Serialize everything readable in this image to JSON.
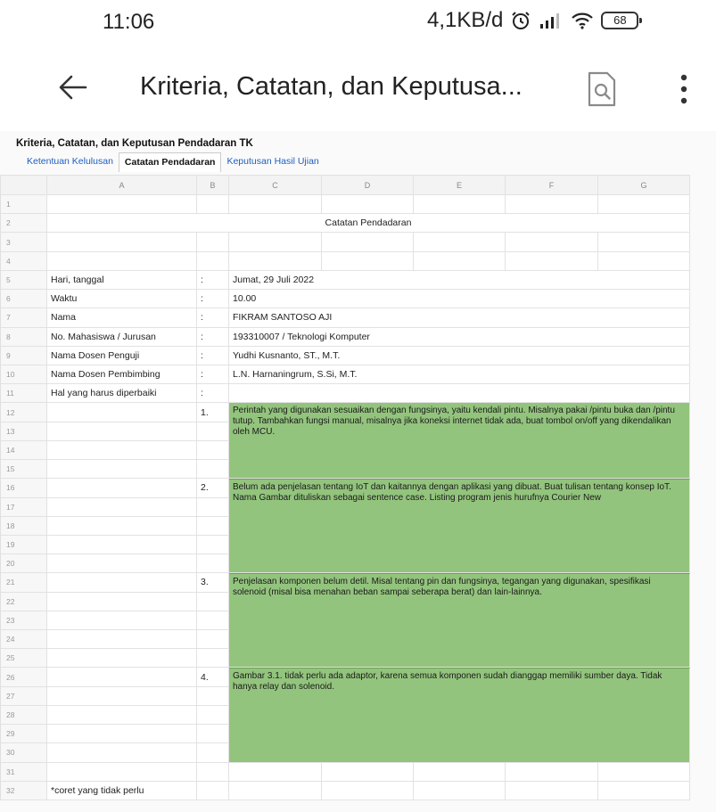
{
  "status_bar": {
    "time": "11:06",
    "net_speed": "4,1KB/d",
    "battery": "68"
  },
  "app_bar": {
    "title": "Kriteria, Catatan, dan Keputusa..."
  },
  "sheet": {
    "doc_title": "Kriteria, Catatan, dan Keputusan Pendadaran TK",
    "tabs": [
      "Ketentuan Kelulusan",
      "Catatan Pendadaran",
      "Keputusan Hasil Ujian"
    ],
    "active_tab": "Catatan Pendadaran",
    "columns": [
      "A",
      "B",
      "C",
      "D",
      "E",
      "F",
      "G"
    ],
    "row_numbers": [
      "1",
      "2",
      "3",
      "4",
      "5",
      "6",
      "7",
      "8",
      "9",
      "10",
      "11",
      "12",
      "13",
      "14",
      "15",
      "16",
      "17",
      "18",
      "19",
      "20",
      "21",
      "22",
      "23",
      "24",
      "25",
      "26",
      "27",
      "28",
      "29",
      "30",
      "31",
      "32"
    ],
    "heading": "Catatan Pendadaran",
    "fields": [
      {
        "label": "Hari, tanggal",
        "sep": ":",
        "value": "Jumat, 29 Juli 2022"
      },
      {
        "label": "Waktu",
        "sep": ":",
        "value": "10.00"
      },
      {
        "label": "Nama",
        "sep": ":",
        "value": "FIKRAM SANTOSO AJI"
      },
      {
        "label": "No. Mahasiswa / Jurusan",
        "sep": ":",
        "value": "193310007 / Teknologi Komputer"
      },
      {
        "label": "Nama Dosen Penguji",
        "sep": ":",
        "value": "Yudhi Kusnanto, ST., M.T."
      },
      {
        "label": "Nama Dosen Pembimbing",
        "sep": ":",
        "value": "L.N. Harnaningrum, S.Si, M.T."
      },
      {
        "label": "Hal yang harus diperbaiki",
        "sep": ":",
        "value": ""
      }
    ],
    "notes": [
      {
        "num": "1.",
        "text": "Perintah yang digunakan sesuaikan dengan fungsinya, yaitu kendali pintu. Misalnya pakai /pintu buka dan /pintu tutup. Tambahkan fungsi manual, misalnya jika koneksi internet tidak ada, buat tombol on/off yang dikendalikan oleh MCU."
      },
      {
        "num": "2.",
        "text": "Belum ada penjelasan tentang IoT dan kaitannya dengan aplikasi yang dibuat. Buat tulisan tentang konsep IoT. Nama Gambar dituliskan sebagai sentence case. Listing program jenis hurufnya Courier New"
      },
      {
        "num": "3.",
        "text": "Penjelasan komponen belum detil. Misal tentang pin dan fungsinya, tegangan yang digunakan, spesifikasi solenoid (misal bisa menahan beban sampai seberapa berat) dan lain-lainnya."
      },
      {
        "num": "4.",
        "text": "Gambar 3.1. tidak perlu ada adaptor, karena semua komponen sudah dianggap memiliki sumber daya. Tidak hanya relay dan solenoid."
      }
    ],
    "footnote": "*coret yang tidak perlu"
  },
  "colors": {
    "note_fill": "#93c47d",
    "link_blue": "#1f5fbf"
  }
}
